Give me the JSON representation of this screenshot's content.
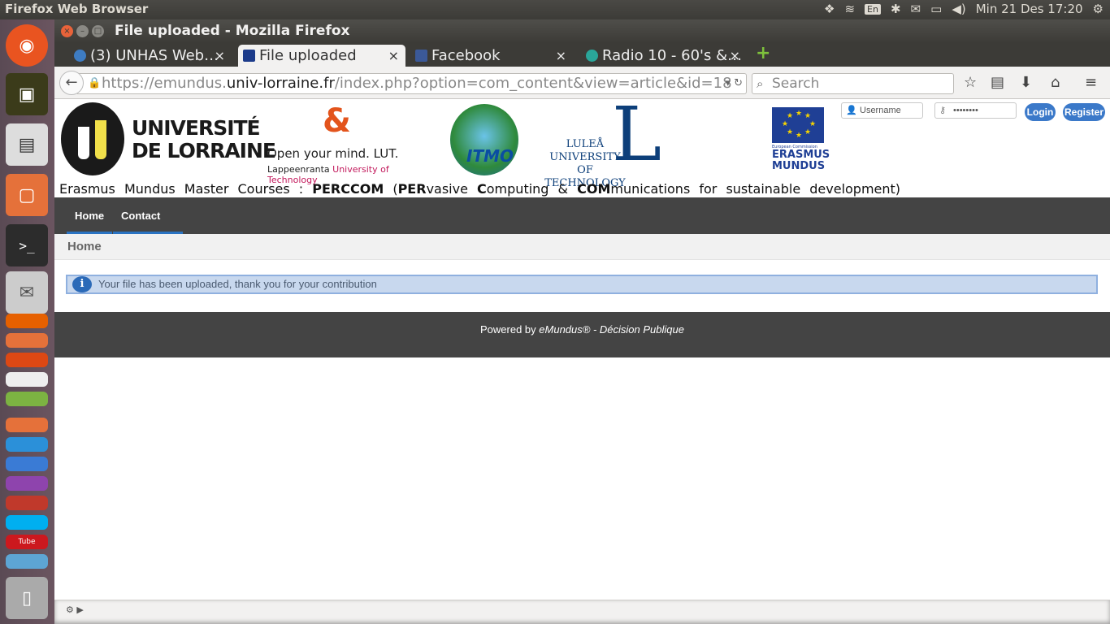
{
  "desktop": {
    "topbar_title": "Firefox Web Browser",
    "lang": "En",
    "clock": "Min 21 Des 17:20",
    "tray_icons": [
      "dropbox-icon",
      "wifi-icon",
      "keyboard-lang-icon",
      "bluetooth-icon",
      "mail-icon",
      "battery-icon",
      "volume-icon",
      "settings-gear-icon"
    ]
  },
  "launcher": {
    "icons": [
      "ubuntu-dash-icon",
      "quran-app-icon",
      "ebook-reader-icon",
      "file-manager-icon",
      "terminal-icon",
      "mail-client-icon",
      "firefox-icon",
      "app-icon",
      "app-icon",
      "app-icon",
      "app-icon",
      "software-center-icon",
      "dropbox-icon",
      "app-icon",
      "thunderbird-icon",
      "app-icon",
      "skype-icon",
      "youtube-icon",
      "app-icon",
      "trash-icon"
    ]
  },
  "window": {
    "title": "File uploaded - Mozilla Firefox",
    "tabs": [
      {
        "label": "(3) UNHAS Web…",
        "icon": "unhas-favicon",
        "active": false
      },
      {
        "label": "File uploaded",
        "icon": "emundus-favicon",
        "active": true
      },
      {
        "label": "Facebook",
        "icon": "facebook-favicon",
        "active": false
      },
      {
        "label": "Radio 10 - 60's &…",
        "icon": "radio-favicon",
        "active": false
      }
    ],
    "new_tab": "+",
    "close_tab": "×"
  },
  "navbar": {
    "url_prefix": "https://emundus.",
    "url_domain": "univ-lorraine.fr",
    "url_suffix": "/index.php?option=com_content&view=article&id=18",
    "search_placeholder": "Search"
  },
  "page": {
    "logos": {
      "udl": "UNIVERSITÉ\nDE LORRAINE",
      "lut_tagline": "Open your mind. LUT.",
      "lut_name_a": "Lappeenranta ",
      "lut_name_b": "University of Technology",
      "itmo": "ITMO",
      "ltu": "LULEÅ\nUNIVERSITY\nOF TECHNOLOGY",
      "eu_commission": "European Commission",
      "eu_erasmus": "ERASMUS\nMUNDUS"
    },
    "login": {
      "username_placeholder": "Username",
      "password_value": "••••••••",
      "login_label": "Login",
      "register_label": "Register"
    },
    "tagline_a": "Erasmus Mundus Master Courses : ",
    "tagline_b": "PERCCOM",
    "tagline_c": " (",
    "tagline_d": "PER",
    "tagline_e": "vasive ",
    "tagline_f": "C",
    "tagline_g": "omputing & ",
    "tagline_h": "COM",
    "tagline_i": "munications  for sustainable development)",
    "menu": [
      "Home",
      "Contact us"
    ],
    "breadcrumb": "Home",
    "message": "Your file has been uploaded, thank you for your contribution",
    "footer_a": "Powered by ",
    "footer_b": "eMundus® - Décision Publique"
  },
  "colors": {
    "menu_bg": "#444444",
    "accent": "#2a73c2",
    "message_bg": "#c8d8ee",
    "launcher_bg": "#6b5560"
  }
}
